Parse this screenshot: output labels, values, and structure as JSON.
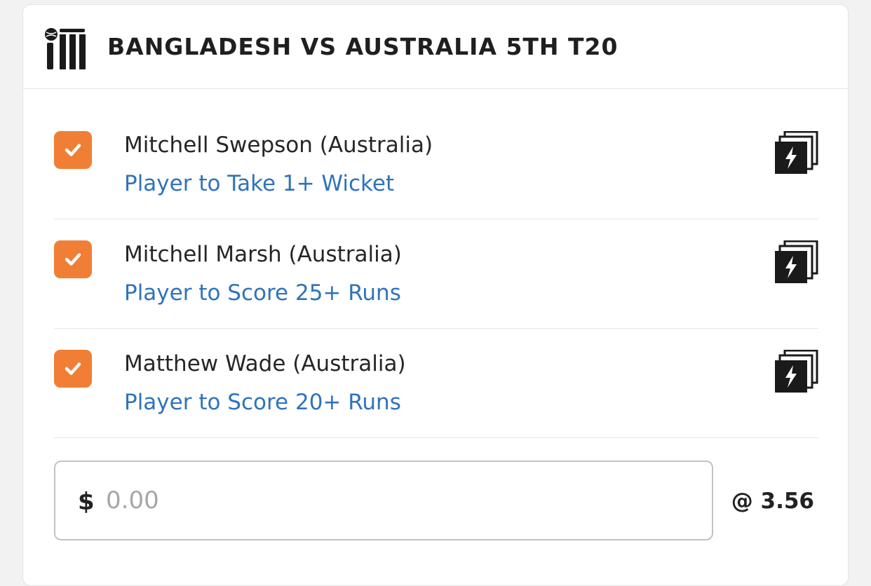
{
  "event": {
    "title": "BANGLADESH VS AUSTRALIA 5TH T20",
    "sport_icon": "cricket-icon"
  },
  "selections": [
    {
      "player": "Mitchell Swepson (Australia)",
      "market": "Player to Take 1+ Wicket",
      "checked": true,
      "icon": "same-game-multi-boost-icon"
    },
    {
      "player": "Mitchell Marsh (Australia)",
      "market": "Player to Score 25+ Runs",
      "checked": true,
      "icon": "same-game-multi-boost-icon"
    },
    {
      "player": "Matthew Wade (Australia)",
      "market": "Player to Score 20+ Runs",
      "checked": true,
      "icon": "same-game-multi-boost-icon"
    }
  ],
  "stake": {
    "currency_symbol": "$",
    "placeholder": "0.00",
    "value": ""
  },
  "odds_label": "@ 3.56",
  "colors": {
    "checkbox": "#f07f35",
    "market_link": "#2f73ba",
    "text": "#262626",
    "border": "#bfc3c8"
  }
}
